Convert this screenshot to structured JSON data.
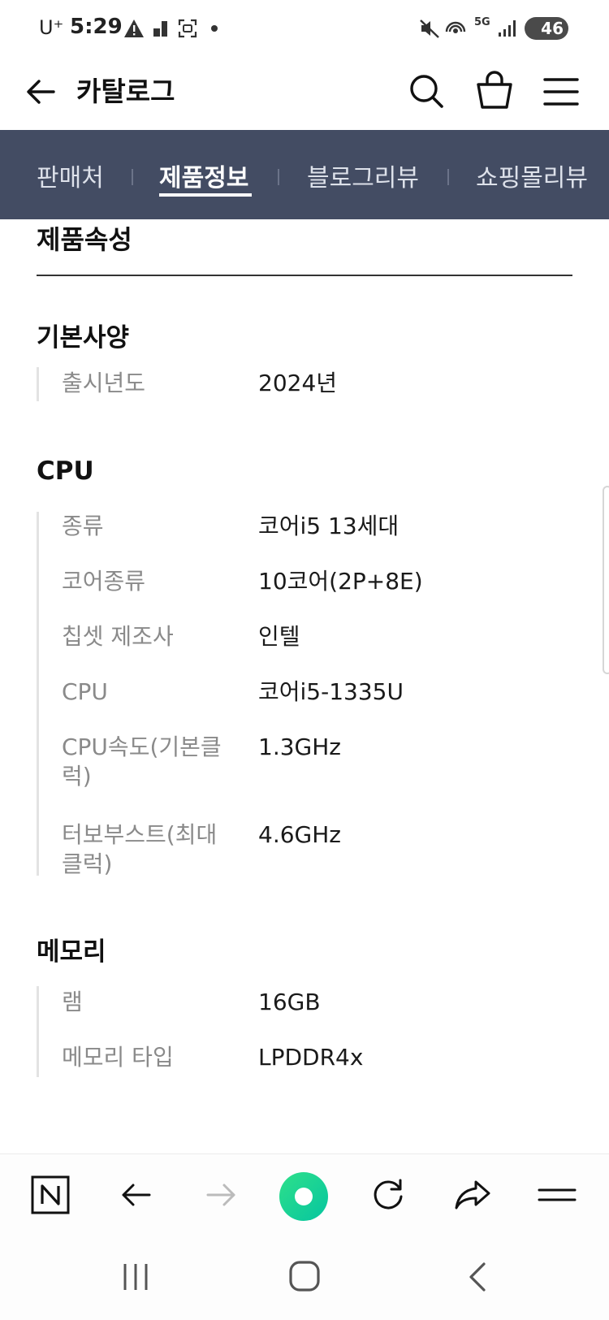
{
  "status_bar": {
    "carrier": "U⁺",
    "time": "5:29",
    "battery": "46",
    "network": "5G"
  },
  "header": {
    "title": "카탈로그",
    "back_icon": "arrow-left-icon",
    "search_icon": "search-icon",
    "cart_icon": "shopping-bag-icon",
    "menu_icon": "hamburger-menu-icon"
  },
  "tabs": [
    {
      "label": "판매처",
      "active": false
    },
    {
      "label": "제품정보",
      "active": true
    },
    {
      "label": "블로그리뷰",
      "active": false
    },
    {
      "label": "쇼핑몰리뷰",
      "active": false
    }
  ],
  "colors": {
    "tab_bar_bg": "#434c63",
    "accent_green": "#1ed78f"
  },
  "content": {
    "page_title": "제품속성",
    "sections": [
      {
        "heading": "기본사양",
        "rows": [
          {
            "label": "출시년도",
            "value": "2024년"
          }
        ]
      },
      {
        "heading": "CPU",
        "rows": [
          {
            "label": "종류",
            "value": "코어i5 13세대"
          },
          {
            "label": "코어종류",
            "value": "10코어(2P+8E)"
          },
          {
            "label": "칩셋 제조사",
            "value": "인텔"
          },
          {
            "label": "CPU",
            "value": "코어i5-1335U"
          },
          {
            "label": "CPU속도(기본클럭)",
            "value": "1.3GHz"
          },
          {
            "label": "터보부스트(최대클럭)",
            "value": "4.6GHz"
          }
        ]
      },
      {
        "heading": "메모리",
        "rows": [
          {
            "label": "램",
            "value": "16GB"
          },
          {
            "label": "메모리 타입",
            "value": "LPDDR4x"
          }
        ]
      }
    ]
  },
  "browser_toolbar": {
    "icons": [
      "naver-n-icon",
      "back-arrow-icon",
      "forward-arrow-icon",
      "green-home-icon",
      "refresh-icon",
      "share-icon",
      "menu-icon"
    ]
  },
  "system_nav": {
    "icons": [
      "recent-apps-icon",
      "home-icon",
      "back-icon"
    ]
  }
}
